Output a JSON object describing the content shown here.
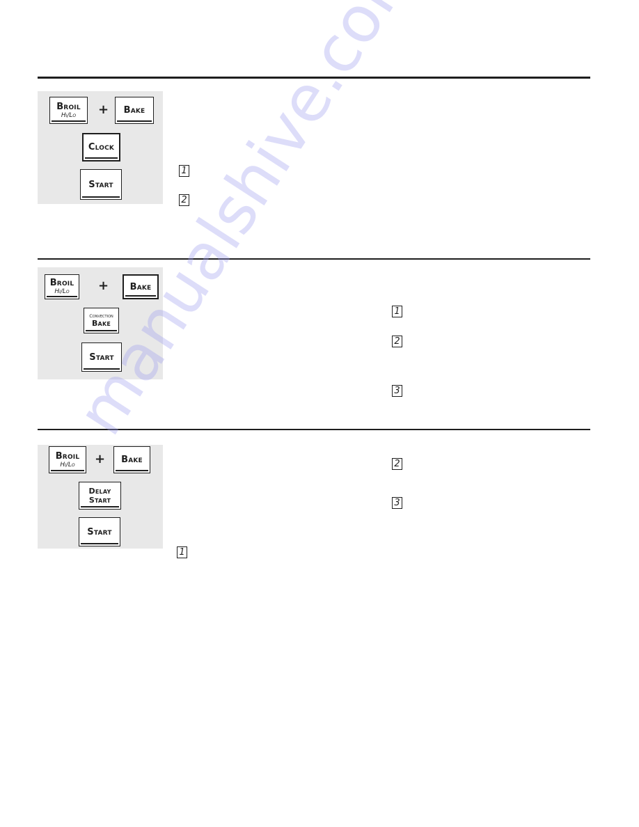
{
  "sections": [
    {
      "keys": {
        "broil": {
          "label": "Broil",
          "sub": "Hi/Lo"
        },
        "plus": "+",
        "bake": {
          "label": "Bake"
        },
        "middle": {
          "label": "Clock"
        },
        "start": {
          "label": "Start"
        }
      },
      "steps": [
        "1",
        "2"
      ]
    },
    {
      "keys": {
        "broil": {
          "label": "Broil",
          "sub": "Hi/Lo"
        },
        "plus": "+",
        "bake": {
          "label": "Bake"
        },
        "middle": {
          "top": "Convection",
          "label": "Bake"
        },
        "start": {
          "label": "Start"
        }
      },
      "steps": [
        "1",
        "2",
        "3"
      ]
    },
    {
      "keys": {
        "broil": {
          "label": "Broil",
          "sub": "Hi/Lo"
        },
        "plus": "+",
        "bake": {
          "label": "Bake"
        },
        "middle": {
          "top": "Delay",
          "label": "Start"
        },
        "start": {
          "label": "Start"
        }
      },
      "steps": [
        "1",
        "2",
        "3"
      ]
    }
  ],
  "watermark": "manualshive.com",
  "colors": {
    "rule": "#1e1e1e",
    "panel": "#e8e8e8",
    "watermark": "#9f9ff0"
  }
}
